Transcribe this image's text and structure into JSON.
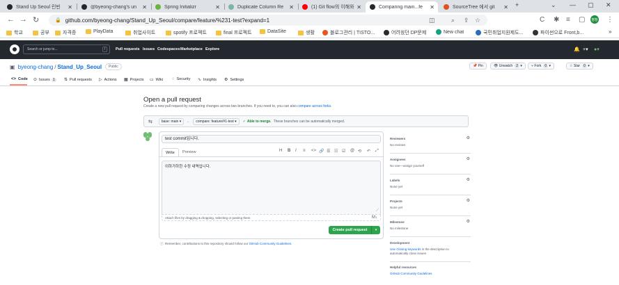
{
  "browser": {
    "tabs": [
      {
        "title": "Stand Up Seoul 린빈",
        "color": "#24292f",
        "active": false
      },
      {
        "title": "@byeong-chang's un",
        "color": "#24292f",
        "active": false
      },
      {
        "title": "Spring Initializr",
        "color": "#6db33f",
        "active": false
      },
      {
        "title": "Duplicate Column Re",
        "color": "#7db3a8",
        "active": false
      },
      {
        "title": "(1) Git flow의 이해와",
        "color": "#ff0000",
        "active": false
      },
      {
        "title": "Comparing main...fe",
        "color": "#24292f",
        "active": true
      },
      {
        "title": "SourceTree 에서 git",
        "color": "#e2501f",
        "active": false
      }
    ],
    "new_tab": "+",
    "window": {
      "minimize": "⌄",
      "restore": "—",
      "max": "▢",
      "close": "✕"
    },
    "url": "github.com/byeong-chang/Stand_Up_Seoul/compare/feature/%231-test?expand=1",
    "profile": "병창",
    "bookmarks": [
      {
        "label": "학교",
        "type": "folder"
      },
      {
        "label": "공부",
        "type": "folder"
      },
      {
        "label": "자격증",
        "type": "folder"
      },
      {
        "label": "PlayData",
        "type": "folder"
      },
      {
        "label": "취업사이트",
        "type": "folder"
      },
      {
        "label": "spotify 프로젝트",
        "type": "folder"
      },
      {
        "label": "final 프로젝트",
        "type": "folder"
      },
      {
        "label": "DataSite",
        "type": "folder"
      },
      {
        "label": "생활",
        "type": "folder"
      },
      {
        "label": "블로그관리 | TISTO...",
        "type": "icon",
        "color": "#eb531f"
      },
      {
        "label": "어려웠던 DP문제",
        "type": "icon",
        "color": "#2b2b2b"
      },
      {
        "label": "New chat",
        "type": "icon",
        "color": "#10a37f"
      },
      {
        "label": "국민취업지원제도...",
        "type": "icon",
        "color": "#2a6ebb"
      },
      {
        "label": "파이썬으로 Front,b...",
        "type": "icon",
        "color": "#333333"
      }
    ],
    "more_bookmarks": "»"
  },
  "github": {
    "search_placeholder": "Search or jump to...",
    "search_key": "/",
    "nav": [
      "Pull requests",
      "Issues",
      "Codespaces",
      "Marketplace",
      "Explore"
    ],
    "repo": {
      "owner": "byeong-chang",
      "name": "Stand_Up_Seoul",
      "visibility": "Public",
      "pin": "Pin",
      "unwatch": "Unwatch",
      "unwatch_count": "2",
      "fork": "Fork",
      "fork_count": "0",
      "star": "Star",
      "star_count": "0"
    },
    "tabs": [
      {
        "label": "Code",
        "icon": "<>"
      },
      {
        "label": "Issues",
        "icon": "⊙",
        "count": "1"
      },
      {
        "label": "Pull requests",
        "icon": "⇅"
      },
      {
        "label": "Actions",
        "icon": "▷"
      },
      {
        "label": "Projects",
        "icon": "▦"
      },
      {
        "label": "Wiki",
        "icon": "▭"
      },
      {
        "label": "Security",
        "icon": "◌"
      },
      {
        "label": "Insights",
        "icon": "∿"
      },
      {
        "label": "Settings",
        "icon": "⚙"
      }
    ]
  },
  "pr": {
    "heading": "Open a pull request",
    "subtitle_pre": "Create a new pull request by comparing changes across two branches. If you need to, you can also",
    "subtitle_link": "compare across forks.",
    "base": "base: main",
    "compare": "compare: feature/#1-test",
    "able": "Able to merge.",
    "able_rest": "These branches can be automatically merged.",
    "title_value": "test commit입니다.",
    "tab_write": "Write",
    "tab_preview": "Preview",
    "toolbar": [
      "H",
      "B",
      "I",
      "≡",
      "<>",
      "🔗",
      "☰",
      "☷",
      "☑",
      "@",
      "⟲",
      "↶",
      "⤢"
    ],
    "body_value": "이하가하한 수정 내역입니다.",
    "attach_text": "Attach files by dragging & dropping, selecting or pasting them.",
    "md_icon": "M↓",
    "create_label": "Create pull request",
    "create_dd": "▾",
    "remember_pre": "Remember, contributions to this repository should follow our",
    "remember_link": "GitHub Community Guidelines."
  },
  "sidebar": {
    "reviewers": {
      "title": "Reviewers",
      "value": "No reviews"
    },
    "assignees": {
      "title": "Assignees",
      "value": "No one—assign yourself"
    },
    "labels": {
      "title": "Labels",
      "value": "None yet"
    },
    "projects": {
      "title": "Projects",
      "value": "None yet"
    },
    "milestone": {
      "title": "Milestone",
      "value": "No milestone"
    },
    "development": {
      "title": "Development",
      "link": "Use Closing keywords",
      "rest": "in the description to automatically close issues"
    },
    "helpful": {
      "title": "Helpful resources",
      "link": "GitHub Community Guidelines"
    }
  },
  "colors": {
    "accent": "#0969da",
    "success": "#2da44e",
    "header": "#24292f"
  }
}
